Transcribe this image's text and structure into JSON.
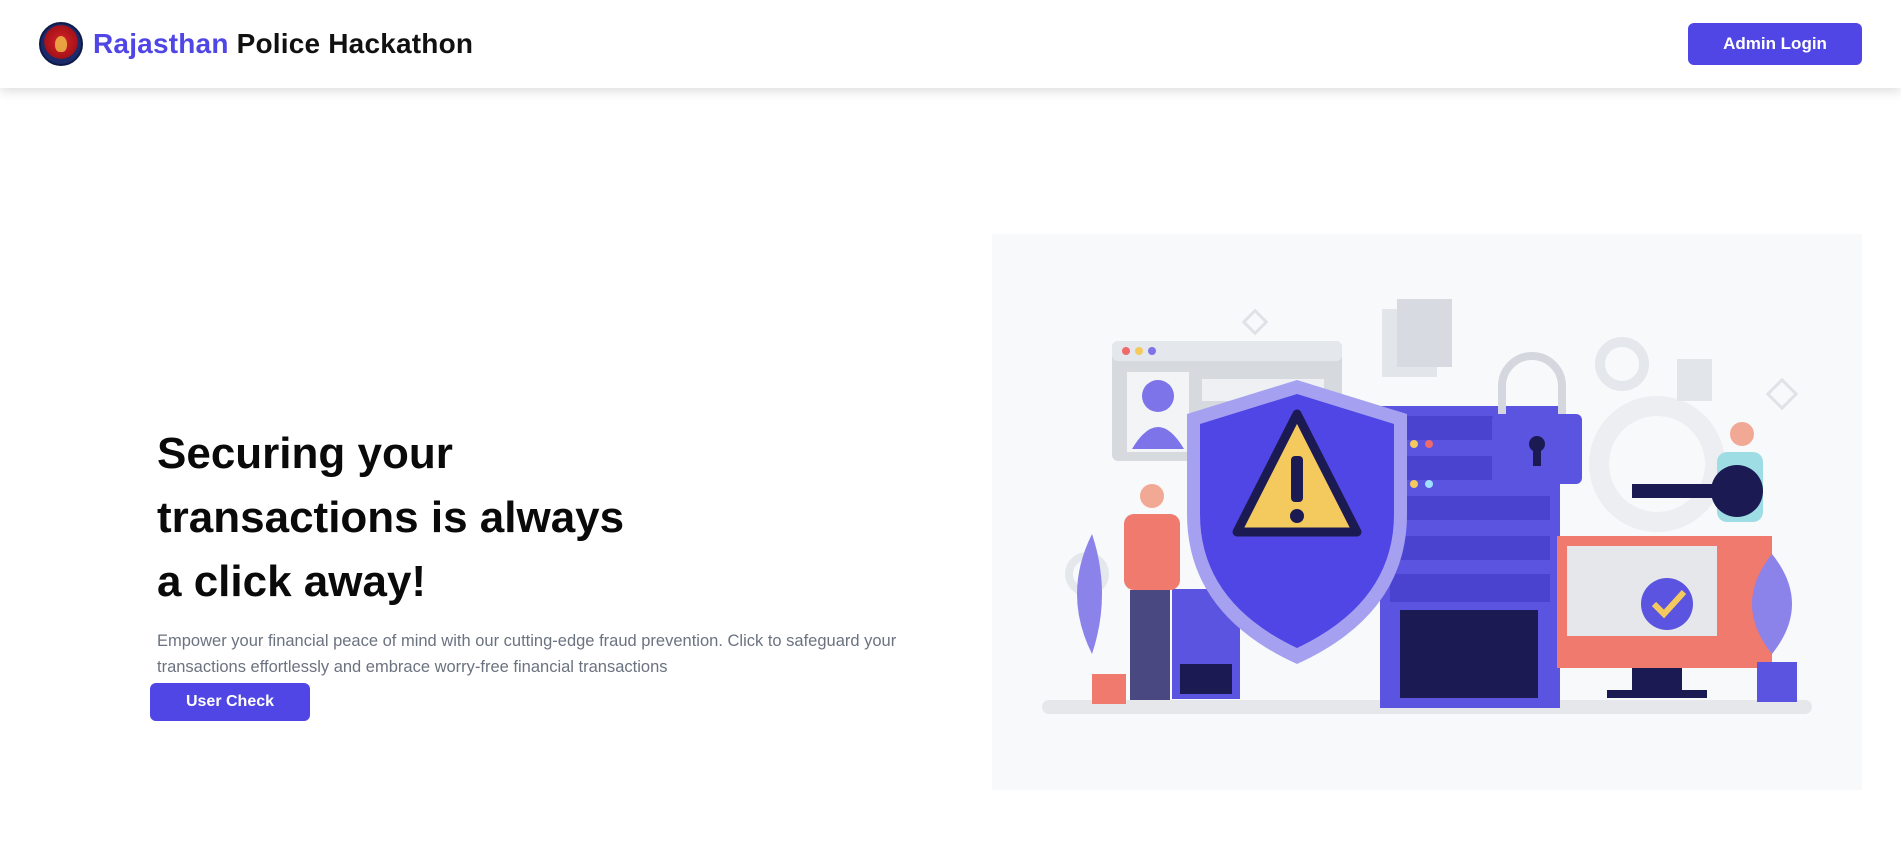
{
  "header": {
    "brand_accent": "Rajasthan",
    "brand_rest": " Police Hackathon",
    "logo_icon": "rajasthan-police-emblem-icon",
    "admin_login_label": "Admin Login"
  },
  "hero": {
    "title_lines": [
      "Securing your",
      "transactions is always",
      "a click away!"
    ],
    "description": "Empower your financial peace of mind with our cutting-edge fraud prevention. Click to safeguard your transactions effortlessly and embrace worry-free financial transactions",
    "user_check_label": "User Check",
    "illustration_icon": "security-shield-warning-illustration"
  },
  "colors": {
    "accent": "#4f46e5",
    "text_muted": "#6b7280",
    "illustration_bg": "#f8f9fb"
  }
}
